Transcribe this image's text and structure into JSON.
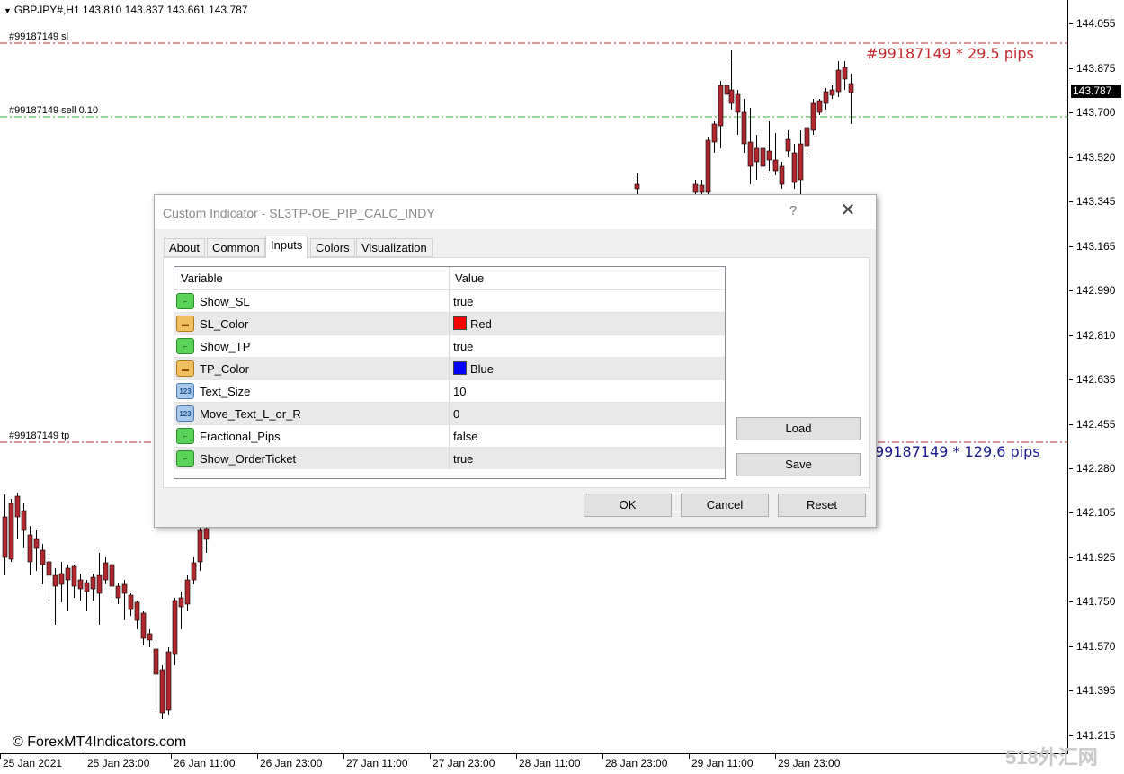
{
  "chart": {
    "symbol": "GBPJPY#,H1  143.810 143.837 143.661 143.787",
    "labels": {
      "sl": "#99187149 sl",
      "sell": "#99187149 sell 0.10",
      "tp": "#99187149 tp"
    },
    "sl_pips": "#99187149 * 29.5 pips",
    "tp_pips": "99187149 * 129.6 pips",
    "copyright": "© ForexMT4Indicators.com",
    "watermark": "518外汇网",
    "price_ticks": [
      "144.055",
      "143.875",
      "143.700",
      "143.520",
      "143.345",
      "143.165",
      "142.990",
      "142.810",
      "142.635",
      "142.455",
      "142.280",
      "142.105",
      "141.925",
      "141.750",
      "141.570",
      "141.395",
      "141.215"
    ],
    "current_price": "143.787",
    "time_ticks": [
      "25 Jan 2021",
      "25 Jan 23:00",
      "26 Jan 11:00",
      "26 Jan 23:00",
      "27 Jan 11:00",
      "27 Jan 23:00",
      "28 Jan 11:00",
      "28 Jan 23:00",
      "29 Jan 11:00",
      "29 Jan 23:00"
    ],
    "colors": {
      "bull": "#3cc25a",
      "bear": "#b0282e",
      "sl_line": "#b03030",
      "sell_line": "#3aa83a",
      "tp_line": "#b03030",
      "sl_text": "#c0282e",
      "tp_text": "#1a1a8c"
    }
  },
  "dialog": {
    "title": "Custom Indicator - SL3TP-OE_PIP_CALC_INDY",
    "help": "?",
    "close": "✕",
    "tabs": [
      "About",
      "Common",
      "Inputs",
      "Colors",
      "Visualization"
    ],
    "active_tab": "Inputs",
    "columns": {
      "variable": "Variable",
      "value": "Value"
    },
    "rows": [
      {
        "name": "Show_SL",
        "value": "true",
        "icon": "bool"
      },
      {
        "name": "SL_Color",
        "value": "Red",
        "icon": "color",
        "swatch": "#ff0000"
      },
      {
        "name": "Show_TP",
        "value": "true",
        "icon": "bool"
      },
      {
        "name": "TP_Color",
        "value": "Blue",
        "icon": "color",
        "swatch": "#0000ff"
      },
      {
        "name": "Text_Size",
        "value": "10",
        "icon": "num"
      },
      {
        "name": "Move_Text_L_or_R",
        "value": "0",
        "icon": "num"
      },
      {
        "name": "Fractional_Pips",
        "value": "false",
        "icon": "bool"
      },
      {
        "name": "Show_OrderTicket",
        "value": "true",
        "icon": "bool"
      }
    ],
    "icon_text": {
      "bool": "⌐",
      "color": "▬",
      "num": "123"
    },
    "buttons": {
      "load": "Load",
      "save": "Save",
      "ok": "OK",
      "cancel": "Cancel",
      "reset": "Reset"
    }
  }
}
